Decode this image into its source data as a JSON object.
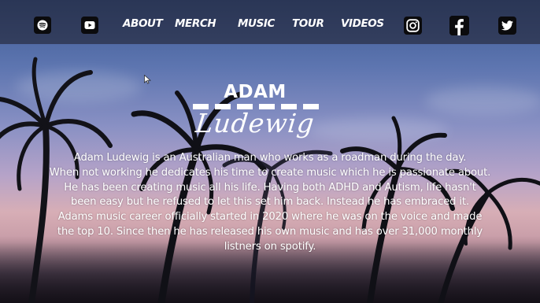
{
  "nav": {
    "links": [
      {
        "label": "ABOUT"
      },
      {
        "label": "MERCH"
      },
      {
        "label": "MUSIC"
      },
      {
        "label": "TOUR"
      },
      {
        "label": "VIDEOS"
      }
    ],
    "social": [
      {
        "icon": "spotify-icon"
      },
      {
        "icon": "youtube-icon"
      },
      {
        "icon": "instagram-icon"
      },
      {
        "icon": "facebook-icon"
      },
      {
        "icon": "twitter-icon"
      }
    ]
  },
  "hero": {
    "first_name": "ADAM",
    "last_name": "Ludewig",
    "bio_lines": [
      "Adam Ludewig is an Australian man who works as a roadman during the day.",
      "When not working he dedicates his time to create music which he is passionate about.",
      "He has been creating music all his life. Having both ADHD and Autism, life hasn't",
      "been easy but he refused to let this set him back. Instead he has embraced it.",
      "Adams music career officially started in 2020 where he was on the voice and made",
      "the top 10. Since then he has released his own music and has over 31,000 monthly",
      "listners on spotify."
    ]
  },
  "colors": {
    "nav_text": "#ffffff",
    "icon_bg": "#0b0b0d",
    "sky_top": "#3d5a93",
    "sky_horizon": "#d7aeb6"
  }
}
